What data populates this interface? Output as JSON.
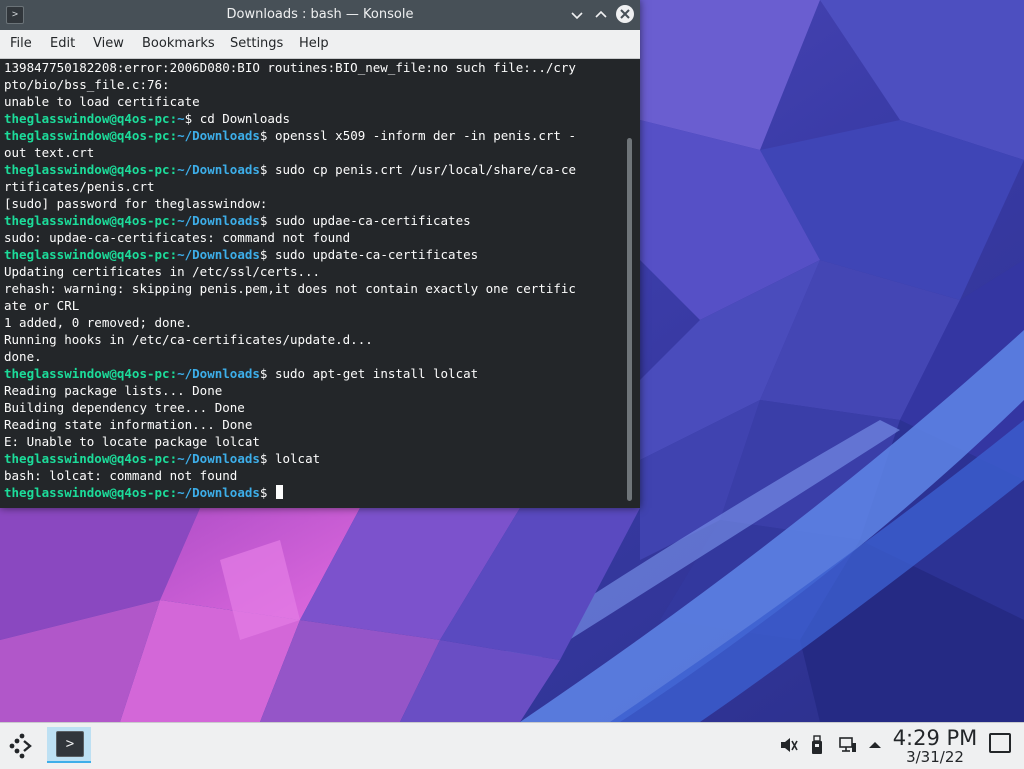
{
  "window": {
    "title": "Downloads : bash — Konsole",
    "app_icon": "terminal-icon",
    "minimize_glyph": "⌵",
    "maximize_glyph": "︿",
    "close_glyph": "✕"
  },
  "menubar": {
    "items": [
      "File",
      "Edit",
      "View",
      "Bookmarks",
      "Settings",
      "Help"
    ]
  },
  "prompt": {
    "user_host": "theglasswindow@q4os-pc",
    "home_path": "~",
    "downloads_path": "~/Downloads",
    "suffix": "$ "
  },
  "terminal": {
    "lines": [
      {
        "type": "out",
        "text": "139847750182208:error:2006D080:BIO routines:BIO_new_file:no such file:../cry"
      },
      {
        "type": "out",
        "text": "pto/bio/bss_file.c:76:"
      },
      {
        "type": "out",
        "text": "unable to load certificate"
      },
      {
        "type": "cmd",
        "path": "~",
        "text": "cd Downloads"
      },
      {
        "type": "cmd",
        "path": "~/Downloads",
        "text": "openssl x509 -inform der -in penis.crt -"
      },
      {
        "type": "out",
        "text": "out text.crt"
      },
      {
        "type": "cmd",
        "path": "~/Downloads",
        "text": "sudo cp penis.crt /usr/local/share/ca-ce"
      },
      {
        "type": "out",
        "text": "rtificates/penis.crt"
      },
      {
        "type": "out",
        "text": "[sudo] password for theglasswindow:"
      },
      {
        "type": "cmd",
        "path": "~/Downloads",
        "text": "sudo updae-ca-certificates"
      },
      {
        "type": "out",
        "text": "sudo: updae-ca-certificates: command not found"
      },
      {
        "type": "cmd",
        "path": "~/Downloads",
        "text": "sudo update-ca-certificates"
      },
      {
        "type": "out",
        "text": "Updating certificates in /etc/ssl/certs..."
      },
      {
        "type": "out",
        "text": "rehash: warning: skipping penis.pem,it does not contain exactly one certific"
      },
      {
        "type": "out",
        "text": "ate or CRL"
      },
      {
        "type": "out",
        "text": "1 added, 0 removed; done."
      },
      {
        "type": "out",
        "text": "Running hooks in /etc/ca-certificates/update.d..."
      },
      {
        "type": "out",
        "text": "done."
      },
      {
        "type": "cmd",
        "path": "~/Downloads",
        "text": "sudo apt-get install lolcat"
      },
      {
        "type": "out",
        "text": "Reading package lists... Done"
      },
      {
        "type": "out",
        "text": "Building dependency tree... Done"
      },
      {
        "type": "out",
        "text": "Reading state information... Done"
      },
      {
        "type": "out",
        "text": "E: Unable to locate package lolcat"
      },
      {
        "type": "cmd",
        "path": "~/Downloads",
        "text": "lolcat"
      },
      {
        "type": "out",
        "text": "bash: lolcat: command not found"
      },
      {
        "type": "cmd",
        "path": "~/Downloads",
        "text": "",
        "cursor": true
      }
    ]
  },
  "taskbar": {
    "launcher_icon": "application-launcher-icon",
    "task_icon": "konsole-icon",
    "tray_icons": [
      "volume-muted-icon",
      "usb-drive-icon",
      "network-icon",
      "expand-tray-icon"
    ],
    "clock_time": "4:29 PM",
    "clock_date": "3/31/22",
    "show_desktop_icon": "show-desktop-icon"
  },
  "colors": {
    "terminal_bg": "#232629",
    "prompt_user": "#1cdc9a",
    "prompt_path": "#3daee9",
    "titlebar": "#475057",
    "panel": "#eff0f1"
  }
}
